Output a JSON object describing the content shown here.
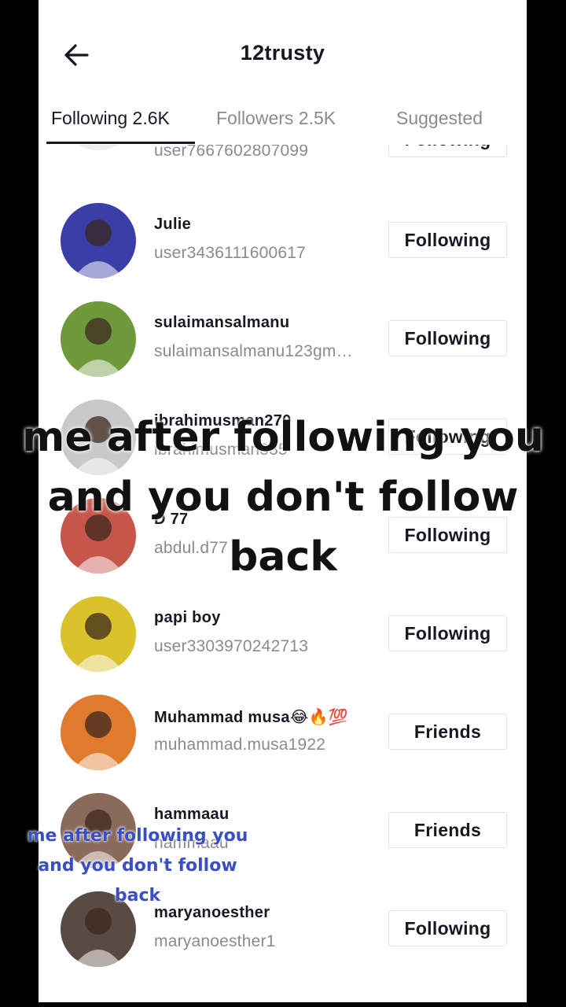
{
  "header": {
    "title": "12trusty"
  },
  "tabs": [
    {
      "label": "Following 2.6K",
      "active": true
    },
    {
      "label": "Followers 2.5K",
      "active": false
    },
    {
      "label": "Suggested",
      "active": false
    }
  ],
  "users": [
    {
      "name": "",
      "handle": "user7667602807099",
      "button": "Following",
      "avatar_color": "#d8d8d8"
    },
    {
      "name": "Julie",
      "handle": "user3436111600617",
      "button": "Following",
      "avatar_color": "#3a3fa8"
    },
    {
      "name": "sulaimansalmanu",
      "handle": "sulaimansalmanu123gm…",
      "button": "Following",
      "avatar_color": "#6f9a3c"
    },
    {
      "name": "ibrahimusman270",
      "handle": "ibrahimusman335",
      "button": "Following",
      "avatar_color": "#c9c9c9"
    },
    {
      "name": "D 77",
      "handle": "abdul.d77",
      "button": "Following",
      "avatar_color": "#c6564a"
    },
    {
      "name": "papi boy",
      "handle": "user3303970242713",
      "button": "Following",
      "avatar_color": "#d9c22a"
    },
    {
      "name": "Muhammad musa😂🔥💯",
      "handle": "muhammad.musa1922",
      "button": "Friends",
      "avatar_color": "#e07a2c"
    },
    {
      "name": "hammaau",
      "handle": "hammaau",
      "button": "Friends",
      "avatar_color": "#8a6a5a"
    },
    {
      "name": "maryanoesther",
      "handle": "maryanoesther1",
      "button": "Following",
      "avatar_color": "#5a4a44"
    }
  ],
  "overlay_caption": {
    "lines": [
      "me after following you",
      "and you don't follow",
      "back"
    ]
  },
  "overlay_caption_small": {
    "lines": [
      "me after following you",
      "and you don't follow",
      "back"
    ]
  },
  "colors": {
    "text": "#161823",
    "muted": "#8a8b91",
    "caption_small": "#3a4fc4"
  }
}
